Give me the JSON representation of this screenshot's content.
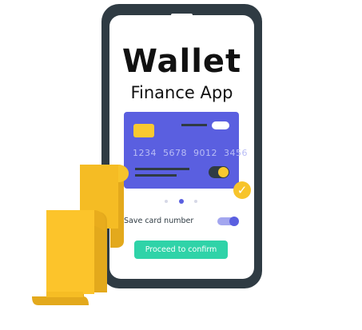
{
  "app": {
    "title": "Wallet",
    "subtitle": "Finance App"
  },
  "card": {
    "number": "1234 5678 9012 3456"
  },
  "carousel": {
    "count": 3,
    "active": 2
  },
  "settings": {
    "save_card_label": "Save card number",
    "save_card_enabled": true
  },
  "actions": {
    "confirm_label": "Proceed to confirm"
  },
  "icons": {
    "check": "check-icon",
    "chip": "card-chip-icon",
    "receipt": "receipt-icon"
  },
  "colors": {
    "phone": "#2f3b43",
    "card": "#5a5fe0",
    "accent_yellow": "#f9c930",
    "confirm": "#2fd3a8"
  }
}
